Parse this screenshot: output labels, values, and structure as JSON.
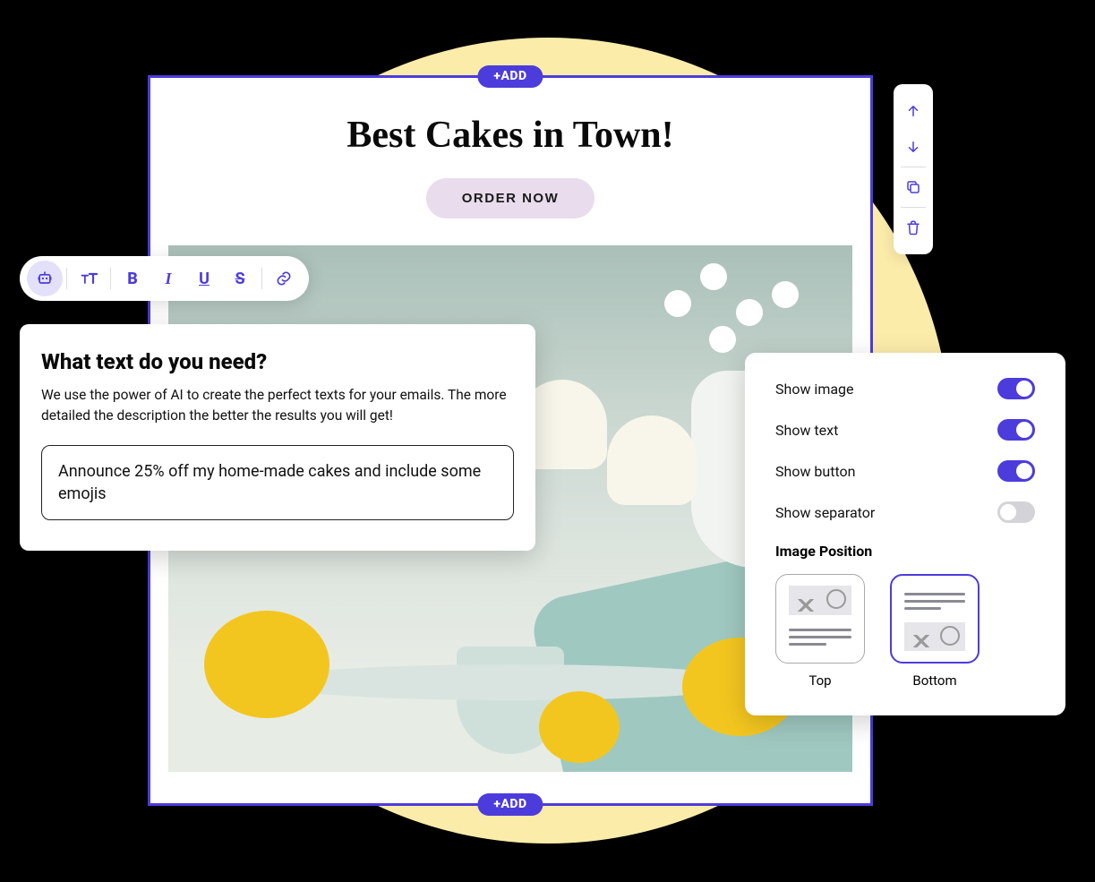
{
  "canvas": {
    "add_label": "+ADD",
    "title": "Best Cakes in Town!",
    "cta_label": "ORDER NOW"
  },
  "toolbar": {
    "ai": "ai-assist",
    "textsize": "text-size",
    "bold": "B",
    "italic": "I",
    "underline": "U",
    "strike": "S",
    "link": "link"
  },
  "ai_panel": {
    "title": "What text do you need?",
    "description": "We use the power of AI to create the perfect texts for your emails. The more detailed the description the better the results you will get!",
    "input_value": "Announce 25% off my home-made cakes and include some emojis"
  },
  "vbar": {
    "up": "move-up",
    "down": "move-down",
    "copy": "duplicate",
    "delete": "delete"
  },
  "settings": {
    "toggles": [
      {
        "label": "Show image",
        "on": true
      },
      {
        "label": "Show text",
        "on": true
      },
      {
        "label": "Show button",
        "on": true
      },
      {
        "label": "Show separator",
        "on": false
      }
    ],
    "image_position_label": "Image Position",
    "positions": [
      {
        "label": "Top",
        "selected": false
      },
      {
        "label": "Bottom",
        "selected": true
      }
    ]
  }
}
